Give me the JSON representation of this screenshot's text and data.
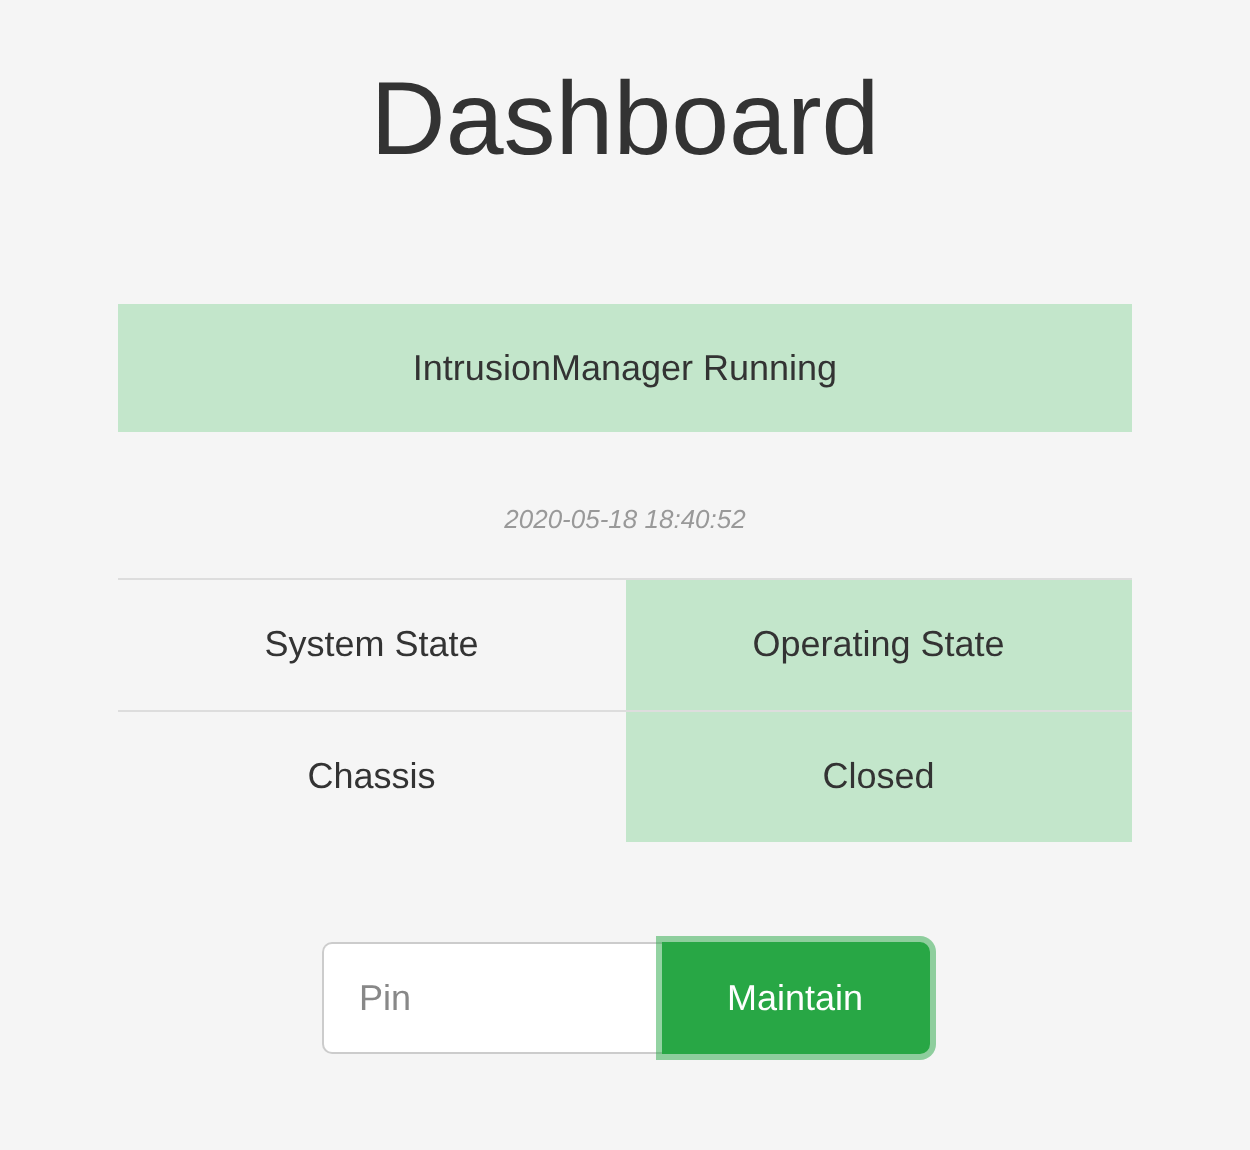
{
  "title": "Dashboard",
  "banner": {
    "text": "IntrusionManager Running",
    "color": "#c3e6cb"
  },
  "timestamp": "2020-05-18 18:40:52",
  "state_table": {
    "rows": [
      {
        "label": "System State",
        "value": "Operating State",
        "color": "#c3e6cb"
      },
      {
        "label": "Chassis",
        "value": "Closed",
        "color": "#c3e6cb"
      }
    ]
  },
  "pin_field": {
    "placeholder": "Pin"
  },
  "maintain_button": {
    "label": "Maintain",
    "focused": true
  }
}
